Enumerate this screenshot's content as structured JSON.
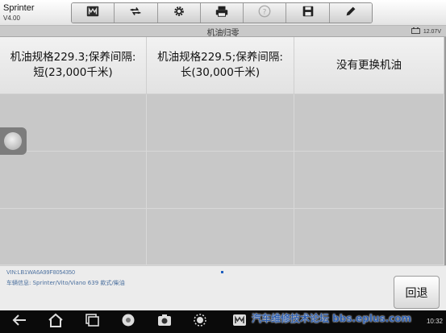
{
  "app": {
    "name": "Sprinter",
    "version": "V4.00"
  },
  "toolbar": {
    "buttons": [
      {
        "name": "home-icon"
      },
      {
        "name": "vehicle-swap-icon"
      },
      {
        "name": "gear-icon"
      },
      {
        "name": "print-icon"
      },
      {
        "name": "help-icon",
        "disabled": true
      },
      {
        "name": "save-icon"
      },
      {
        "name": "edit-icon"
      }
    ]
  },
  "header": {
    "title": "机油归零",
    "battery_voltage": "12.07V"
  },
  "options": [
    {
      "line1": "机油规格229.3;保养间隔:",
      "line2": "短(23,000千米)"
    },
    {
      "line1": "机油规格229.5;保养间隔:",
      "line2": "长(30,000千米)"
    },
    {
      "line1": "没有更换机油",
      "line2": ""
    }
  ],
  "footer": {
    "vin": "VIN:LB1WA6A99F8054350",
    "vehicle_info": "车辆信息: Sprinter/Vito/Viano 639 款式/柴油",
    "back_label": "回退"
  },
  "navbar": {
    "icons": [
      "back-icon",
      "home-icon",
      "recent-apps-icon",
      "browser-icon",
      "camera-icon",
      "brightness-icon",
      "vehicle-icon"
    ],
    "watermark": "汽车维修技术论坛 bbs.eplus.com",
    "clock": "10:32"
  },
  "colors": {
    "link_text": "#4a6f9e",
    "accent": "#1e5fbf",
    "watermark": "#2f5fae"
  }
}
